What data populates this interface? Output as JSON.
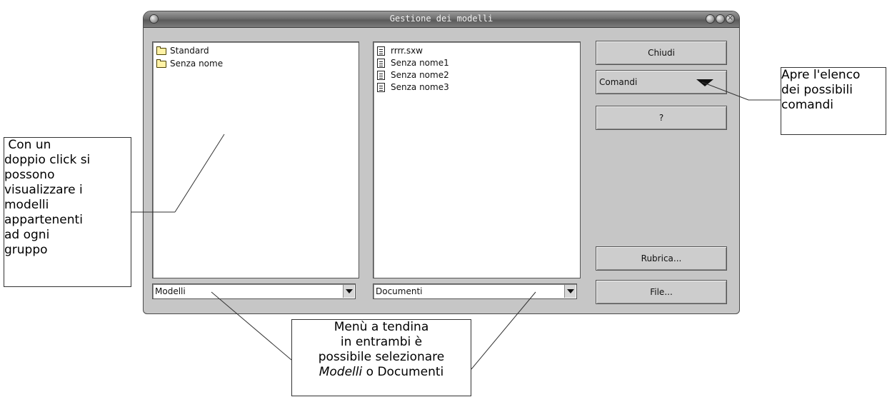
{
  "window": {
    "title": "Gestione dei modelli",
    "buttons": [
      "●",
      "▭",
      "✕"
    ]
  },
  "left_list": {
    "items": [
      {
        "icon": "folder-icon",
        "label": "Standard"
      },
      {
        "icon": "folder-icon",
        "label": "Senza nome"
      }
    ],
    "selector": {
      "value": "Modelli"
    }
  },
  "right_list": {
    "items": [
      {
        "icon": "document-icon",
        "label": "rrrr.sxw"
      },
      {
        "icon": "document-icon",
        "label": "Senza nome1"
      },
      {
        "icon": "document-icon",
        "label": "Senza nome2"
      },
      {
        "icon": "document-icon",
        "label": "Senza nome3"
      }
    ],
    "selector": {
      "value": "Documenti"
    }
  },
  "side_buttons": {
    "close": "Chiudi",
    "commands": "Comandi",
    "help": "?",
    "address_book": "Rubrica...",
    "file": "File..."
  },
  "annotations": {
    "commands_note": [
      "Apre l'elenco",
      "dei possibili",
      "comandi"
    ],
    "doubleclick_note": [
      " Con un",
      "doppio click si",
      "possono",
      "visualizzare i",
      "modelli",
      "appartenenti",
      "ad ogni",
      "gruppo"
    ],
    "dropdown_note": [
      "Menù a tendina",
      "in entrambi è",
      "possibile selezionare"
    ],
    "dropdown_note_last": {
      "italic": "Modelli",
      "rest": " o Documenti"
    }
  }
}
